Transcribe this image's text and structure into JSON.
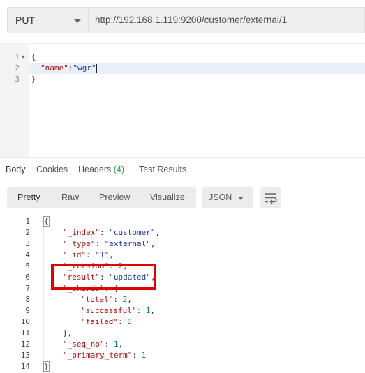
{
  "request": {
    "method": "PUT",
    "url": "http://192.168.1.119:9200/customer/external/1"
  },
  "request_editor": {
    "lines": [
      {
        "num": "1",
        "text": "{"
      },
      {
        "num": "2",
        "key": "\"name\"",
        "sep": ":",
        "value": "\"wgr\""
      },
      {
        "num": "3",
        "text": "}"
      }
    ]
  },
  "response_tabs": {
    "body": "Body",
    "cookies": "Cookies",
    "headers": "Headers",
    "headers_count": "(4)",
    "test_results": "Test Results"
  },
  "toolbar": {
    "pretty": "Pretty",
    "raw": "Raw",
    "preview": "Preview",
    "visualize": "Visualize",
    "format": "JSON"
  },
  "response_body": {
    "lines": [
      {
        "num": "1",
        "text": "{"
      },
      {
        "num": "2",
        "key": "\"_index\"",
        "value": "\"customer\"",
        "vtype": "s",
        "end": ","
      },
      {
        "num": "3",
        "key": "\"_type\"",
        "value": "\"external\"",
        "vtype": "s",
        "end": ","
      },
      {
        "num": "4",
        "key": "\"_id\"",
        "value": "\"1\"",
        "vtype": "s",
        "end": ","
      },
      {
        "num": "5",
        "key": "\"_version\"",
        "value": "2",
        "vtype": "n",
        "end": ","
      },
      {
        "num": "6",
        "key": "\"result\"",
        "value": "\"updated\"",
        "vtype": "s",
        "end": ","
      },
      {
        "num": "7",
        "key": "\"_shards\"",
        "value": "{",
        "vtype": "p",
        "end": ""
      },
      {
        "num": "8",
        "key": "\"total\"",
        "value": "2",
        "vtype": "n",
        "end": ",",
        "indent": 2
      },
      {
        "num": "9",
        "key": "\"successful\"",
        "value": "1",
        "vtype": "n",
        "end": ",",
        "indent": 2
      },
      {
        "num": "10",
        "key": "\"failed\"",
        "value": "0",
        "vtype": "n",
        "end": "",
        "indent": 2
      },
      {
        "num": "11",
        "text": "},",
        "indent": 1
      },
      {
        "num": "12",
        "key": "\"_seq_no\"",
        "value": "1",
        "vtype": "n",
        "end": ","
      },
      {
        "num": "13",
        "key": "\"_primary_term\"",
        "value": "1",
        "vtype": "n",
        "end": ""
      },
      {
        "num": "14",
        "text": "}"
      }
    ]
  },
  "colors": {
    "annotation": "#e00000",
    "string": "#1f3aa8",
    "number": "#098658",
    "key": "#aa1111",
    "headers_count": "#2e9e4f"
  }
}
